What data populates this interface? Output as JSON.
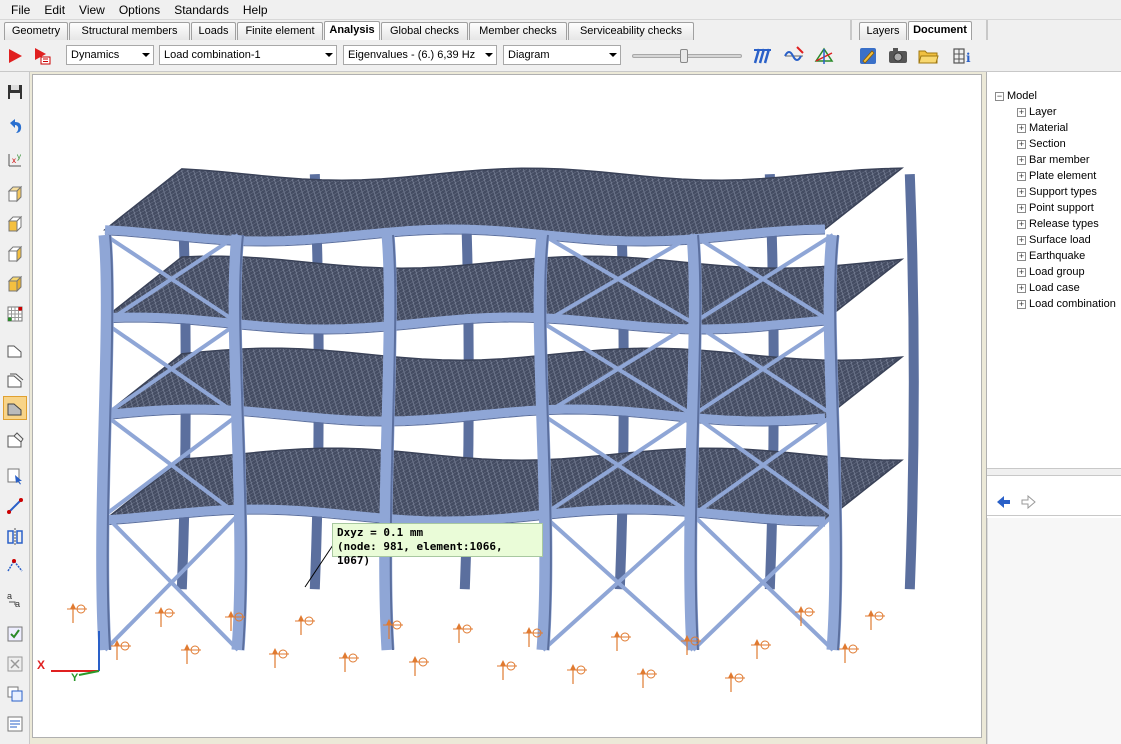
{
  "menu": [
    "File",
    "Edit",
    "View",
    "Options",
    "Standards",
    "Help"
  ],
  "tabs": [
    "Geometry",
    "Structural members",
    "Loads",
    "Finite element",
    "Analysis",
    "Global checks",
    "Member checks",
    "Serviceability checks"
  ],
  "active_tab": "Analysis",
  "side_tabs": [
    "Layers",
    "Document"
  ],
  "active_side_tab": "Document",
  "toolbar": {
    "analysis_type": "Dynamics",
    "load_combination": "Load combination-1",
    "eigenvalue": "Eigenvalues - (6.)  6,39 Hz",
    "display_mode": "Diagram",
    "slider_fraction": 0.5
  },
  "tooltip": {
    "line1": "Dxyz = 0.1 mm",
    "line2": "(node: 981, element:1066, 1067)"
  },
  "axes": {
    "x": "X",
    "y": "Y"
  },
  "tree": {
    "root": "Model",
    "items": [
      "Layer",
      "Material",
      "Section",
      "Bar member",
      "Plate element",
      "Support types",
      "Point support",
      "Release types",
      "Surface load",
      "Earthquake",
      "Load group",
      "Load case",
      "Load combination"
    ]
  },
  "colors": {
    "frame": "#8fa6d6",
    "frame_dark": "#5b6f9e",
    "slab": "#3a4258",
    "support": "#e07a30",
    "tooltip_bg": "#eafcd8",
    "accent": "#e8a020"
  }
}
